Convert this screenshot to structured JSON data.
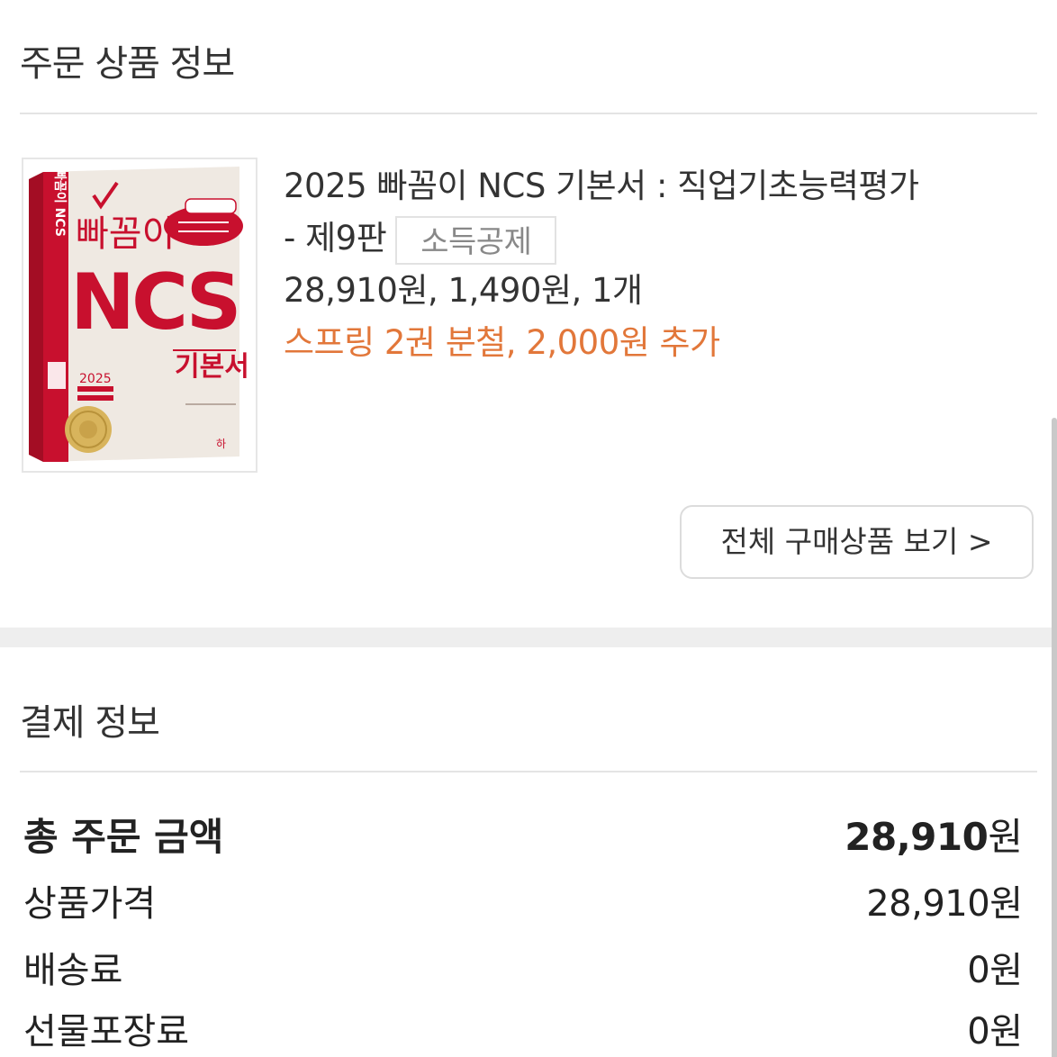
{
  "order_section": {
    "title": "주문 상품 정보"
  },
  "product": {
    "name_line1": "2025 빠꼼이 NCS 기본서 : 직업기초능력평가",
    "name_line2": "- 제9판",
    "tag": "소득공제",
    "price_summary": "28,910원, 1,490원, 1개",
    "option_note": "스프링 2권 분철, 2,000원 추가",
    "cover": {
      "brand": "빠꼼이",
      "title": "NCS",
      "subtitle": "기본서",
      "spine_text": "빠꼼이 NCS",
      "year_badge": "2025",
      "publisher": "하",
      "accent_color": "#c8102e"
    }
  },
  "view_all_button": {
    "label": "전체 구매상품 보기 >"
  },
  "payment_section": {
    "title": "결제 정보",
    "rows": [
      {
        "label": "총 주문 금액",
        "value": "28,910",
        "unit": "원"
      },
      {
        "label": "상품가격",
        "value": "28,910",
        "unit": "원"
      },
      {
        "label": "배송료",
        "value": "0",
        "unit": "원"
      },
      {
        "label": "선물포장료",
        "value": "0",
        "unit": "원"
      }
    ]
  }
}
